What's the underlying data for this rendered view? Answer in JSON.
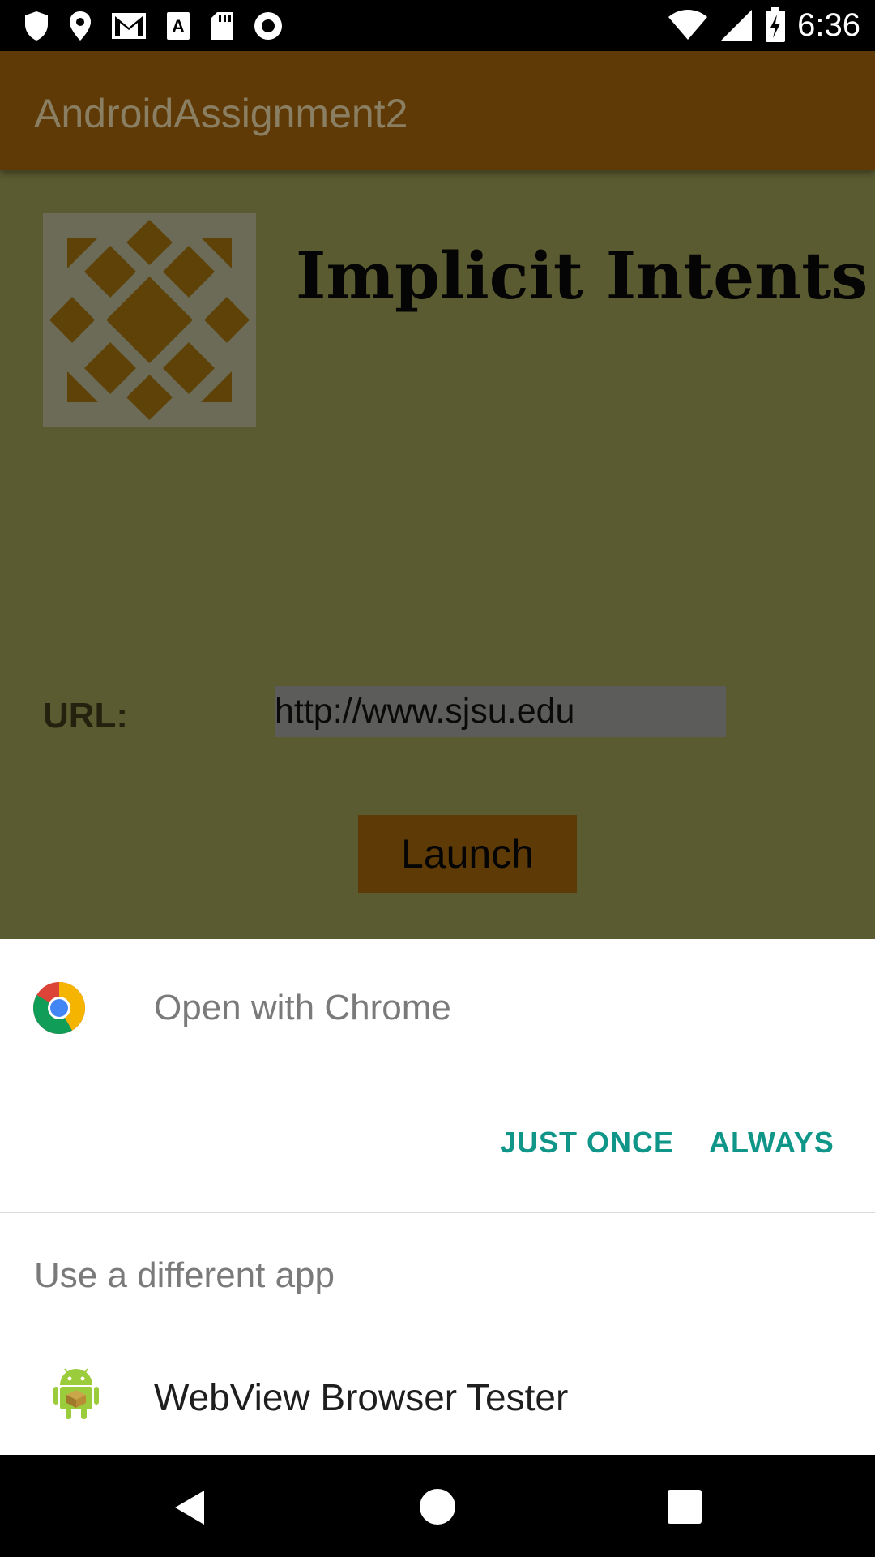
{
  "status_bar": {
    "time": "6:36",
    "left_icons": [
      "shield-icon",
      "location-pin-icon",
      "gmail-icon",
      "font-icon",
      "sd-card-icon",
      "record-icon"
    ],
    "right_icons": [
      "wifi-icon",
      "signal-icon",
      "battery-charging-icon"
    ]
  },
  "app": {
    "title": "AndroidAssignment2",
    "heading": "Implicit Intents",
    "url_label": "URL:",
    "url_value": "http://www.sjsu.edu",
    "launch_label": "Launch"
  },
  "sheet": {
    "open_with": "Open with Chrome",
    "just_once": "JUST ONCE",
    "always": "ALWAYS",
    "use_different": "Use a different app",
    "apps": [
      {
        "label": "WebView Browser Tester",
        "icon": "android-icon"
      }
    ]
  },
  "colors": {
    "app_bar": "#5f3a06",
    "content_bg": "#5b5b31",
    "accent": "#0f9688",
    "launch_button": "#5e3a06"
  },
  "nav_bar": {
    "icons": [
      "back-icon",
      "home-icon",
      "recents-icon"
    ]
  }
}
